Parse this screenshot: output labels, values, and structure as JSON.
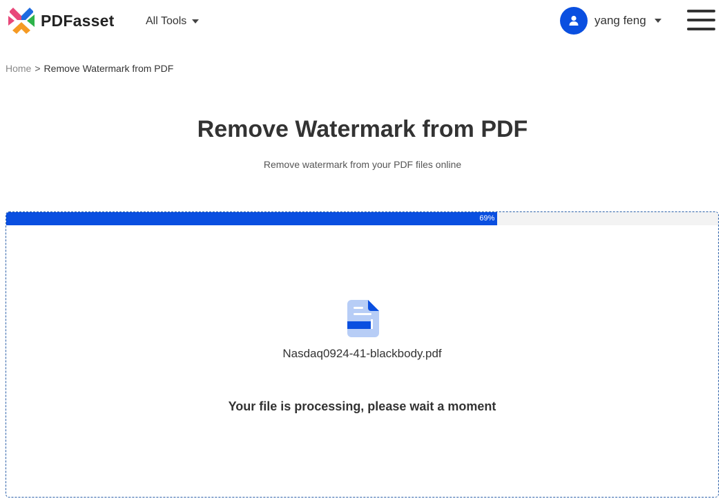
{
  "header": {
    "logo_text": "PDFasset",
    "all_tools_label": "All Tools",
    "user_name": "yang feng"
  },
  "breadcrumb": {
    "home": "Home",
    "separator": ">",
    "current": "Remove Watermark from PDF"
  },
  "main": {
    "title": "Remove Watermark from PDF",
    "subtitle": "Remove watermark from your PDF files online"
  },
  "upload": {
    "progress_percent": 69,
    "progress_label": "69%",
    "file_name": "Nasdaq0924-41-blackbody.pdf",
    "status_message": "Your file is processing, please wait a moment"
  },
  "icons": {
    "logo": "pdfasset-logo-icon",
    "user": "user-icon",
    "menu": "hamburger-menu-icon",
    "file": "pdf-file-icon"
  },
  "colors": {
    "accent": "#0a4fe0",
    "progress_track": "#f3f3f3",
    "dashed_border": "#2a5fa8",
    "logo_pink": "#e8487a",
    "logo_blue": "#1e6be0",
    "logo_green": "#2db34a",
    "logo_orange": "#f59a23"
  }
}
